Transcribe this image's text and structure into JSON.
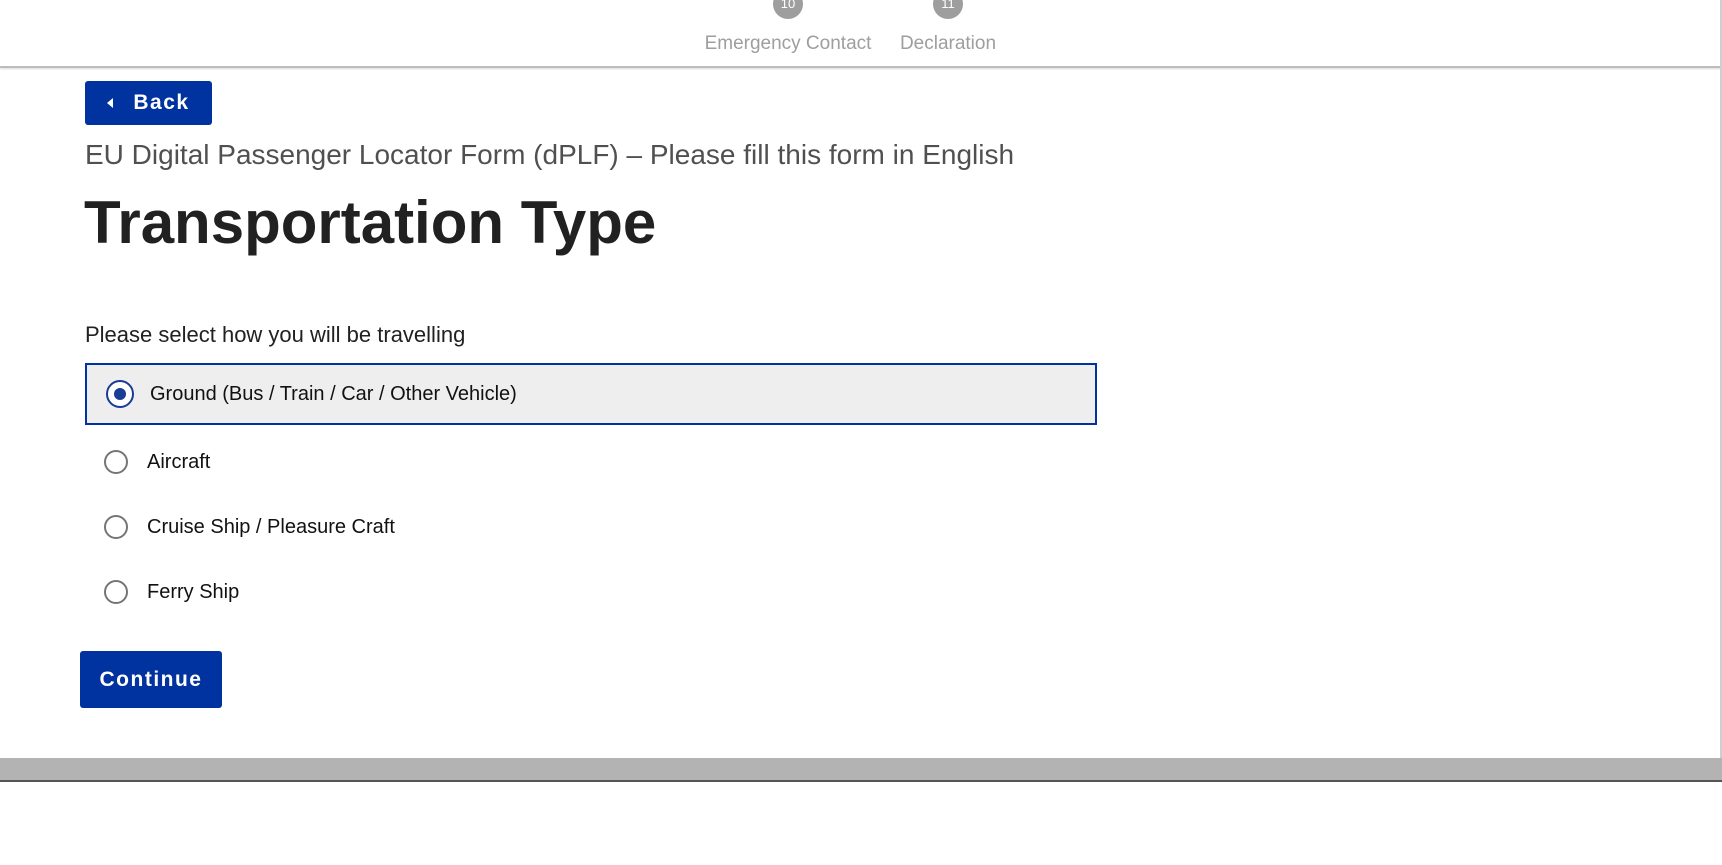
{
  "stepper": {
    "steps": [
      {
        "number": "10",
        "label": "Emergency Contact"
      },
      {
        "number": "11",
        "label": "Declaration"
      }
    ]
  },
  "back_button": {
    "label": "Back"
  },
  "form_subtitle": "EU Digital Passenger Locator Form (dPLF) – Please fill this form in English",
  "page_title": "Transportation Type",
  "question": {
    "label": "Please select how you will be travelling",
    "selected_index": 0,
    "options": [
      {
        "label": "Ground (Bus / Train / Car / Other Vehicle)",
        "selected": true
      },
      {
        "label": "Aircraft",
        "selected": false
      },
      {
        "label": "Cruise Ship / Pleasure Craft",
        "selected": false
      },
      {
        "label": "Ferry Ship",
        "selected": false
      }
    ]
  },
  "continue_button": {
    "label": "Continue"
  },
  "colors": {
    "primary": "#0033a0",
    "selected_background": "#eeeeee",
    "step_inactive": "#9e9e9e"
  }
}
